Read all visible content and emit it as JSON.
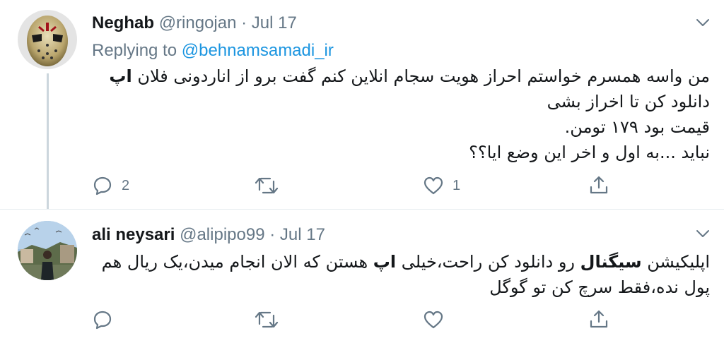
{
  "tweets": [
    {
      "name": "Neghab",
      "handle": "@ringojan",
      "separator": "·",
      "date": "Jul 17",
      "replying_prefix": "Replying to ",
      "replying_to": "@behnamsamadi_ir",
      "lines": [
        {
          "pre": "من واسه همسرم خواستم احراز هویت سجام انلاین کنم گفت برو از اناردونی فلان ",
          "bold": "اپ",
          "post": ""
        },
        {
          "pre": "دانلود کن تا اخراز بشی",
          "bold": "",
          "post": ""
        },
        {
          "pre": "قیمت بود ۱۷۹ تومن.",
          "bold": "",
          "post": ""
        },
        {
          "pre": "نباید ...به اول و اخر این وضع ایا؟؟",
          "bold": "",
          "post": ""
        }
      ],
      "reply_count": "2",
      "retweet_count": "",
      "like_count": "1"
    },
    {
      "name": "ali neysari",
      "handle": "@alipipo99",
      "separator": "·",
      "date": "Jul 17",
      "lines": [
        {
          "pre": "اپلیکیشن ",
          "bold": "سیگنال",
          "post": " رو دانلود کن راحت،خیلی ",
          "bold2": "اپ",
          "post2": " هستن که الان انجام میدن،یک ریال هم"
        },
        {
          "pre": "پول نده،فقط سرچ کن تو گوگل",
          "bold": "",
          "post": ""
        }
      ],
      "reply_count": "",
      "retweet_count": "",
      "like_count": ""
    }
  ],
  "icons": {
    "reply": "reply-icon",
    "retweet": "retweet-icon",
    "like": "heart-icon",
    "share": "share-icon",
    "caret": "chevron-down-icon"
  },
  "colors": {
    "accent": "#1b95e0",
    "muted": "#657786",
    "line": "#ccd6dd"
  }
}
